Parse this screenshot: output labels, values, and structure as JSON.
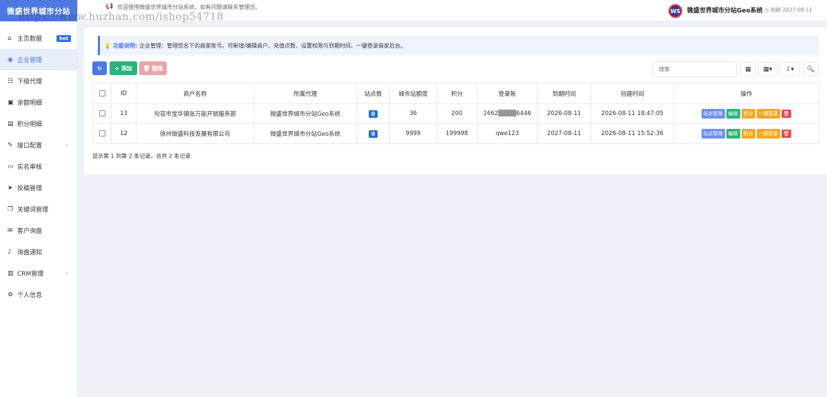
{
  "brand": "微盛世界城市分站",
  "watermark": "https://www.huzhan.com/ishop54718",
  "sidebar": {
    "items": [
      {
        "icon": "⌂",
        "name": "home",
        "label": "主页数据",
        "badge": "hot"
      },
      {
        "icon": "◉",
        "name": "enterprise",
        "label": "企业管理",
        "active": true
      },
      {
        "icon": "☷",
        "name": "agents",
        "label": "下级代理"
      },
      {
        "icon": "▣",
        "name": "balance",
        "label": "余额明细"
      },
      {
        "icon": "▤",
        "name": "points",
        "label": "积分明细"
      },
      {
        "icon": "✎",
        "name": "api",
        "label": "接口配置",
        "arrow": "‹"
      },
      {
        "icon": "▭",
        "name": "realname",
        "label": "实名审核"
      },
      {
        "icon": "➤",
        "name": "submission",
        "label": "投稿管理"
      },
      {
        "icon": "❐",
        "name": "keywords",
        "label": "关键词管理"
      },
      {
        "icon": "✉",
        "name": "inquiry",
        "label": "客户询盘"
      },
      {
        "icon": "♪",
        "name": "notify",
        "label": "询盘通知"
      },
      {
        "icon": "▥",
        "name": "crm",
        "label": "CRM管理",
        "arrow": "‹"
      },
      {
        "icon": "⚙",
        "name": "profile",
        "label": "个人信息"
      }
    ]
  },
  "header": {
    "welcome": "欢迎使用微盛世界城市分站系统，如有问题请联系管理员。",
    "logo_text": "WS",
    "system_name": "微盛世界城市分站Geo系统",
    "expire": "◷ 到期 2027-08-11"
  },
  "info": {
    "title": "功能说明:",
    "text": "企业管理：管理您名下的商家账号。可新增/编辑商户、充值点数、设置权限与到期时间、一键登录商家后台。"
  },
  "toolbar": {
    "refresh": "↻",
    "add": "+ 添加",
    "delete": "🗑 删除",
    "search_placeholder": "搜索",
    "icons": [
      "▦",
      "▦▾",
      "⇩▾",
      "🔍"
    ]
  },
  "table": {
    "columns": [
      "ID",
      "商户名称",
      "所属代理",
      "站点数",
      "城市站额度",
      "积分",
      "登录账",
      "到期时间",
      "创建时间",
      "操作"
    ],
    "rows": [
      {
        "id": "13",
        "name": "句容市宝华镇张万能开锁服务部",
        "agent": "微盛世界城市分站Geo系统",
        "sites": "0",
        "quota": "36",
        "points": "200",
        "account": "1662▒▒▒▒6446",
        "expire": "2026-08-11",
        "created": "2026-08-11 18:47:05"
      },
      {
        "id": "12",
        "name": "徐州微盛科技发展有限公司",
        "agent": "微盛世界城市分站Geo系统",
        "sites": "0",
        "quota": "9999",
        "points": "199998",
        "account": "qwe123",
        "expire": "2027-08-11",
        "created": "2026-08-11 15:52:36"
      }
    ],
    "actions": {
      "site": "站点管理",
      "edit": "编辑",
      "points": "积分",
      "login": "一键登录",
      "delete": "🗑"
    }
  },
  "pager": "显示第 1 到第 2 条记录，总共 2 条记录"
}
